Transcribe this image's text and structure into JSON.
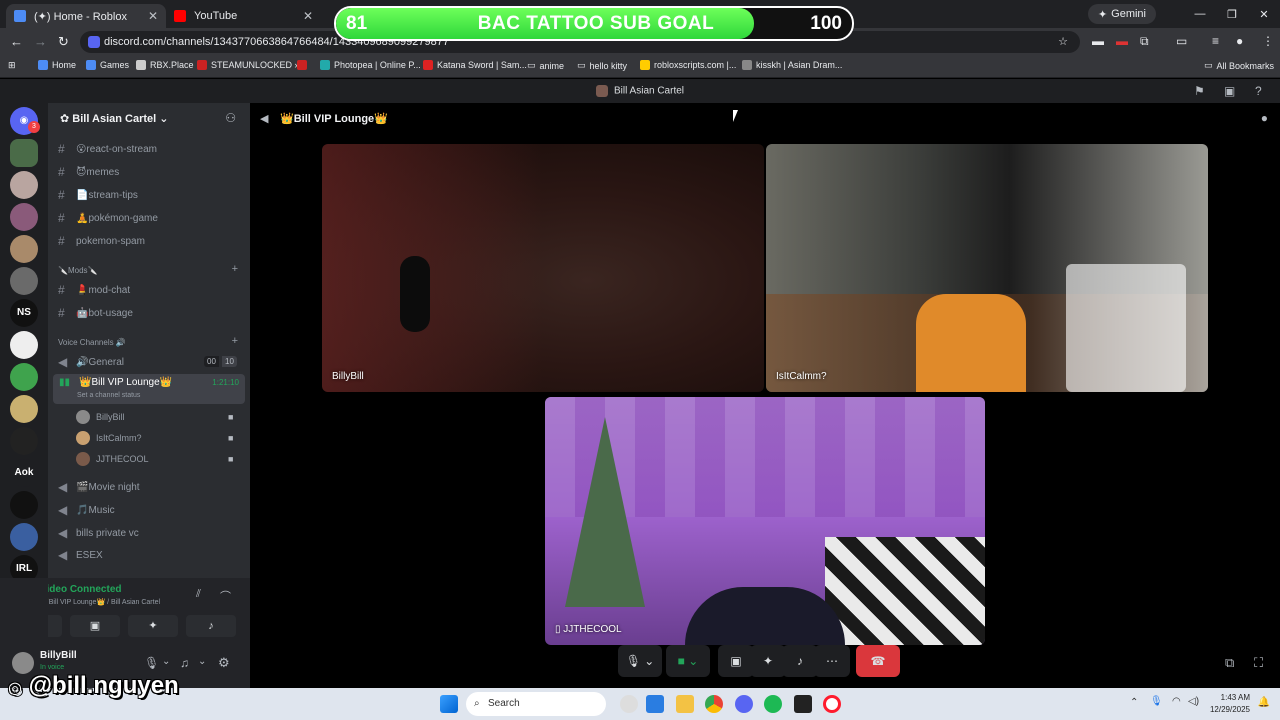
{
  "browser": {
    "tabs": [
      {
        "title": "(✦) Home - Roblox",
        "color": "#4d8cf5"
      },
      {
        "title": "YouTube",
        "color": "#ff0000"
      }
    ],
    "gemini_label": "Gemini",
    "url": "discord.com/channels/1343770663864766484/1433409689099279877",
    "bookmarks": [
      "Home",
      "Games",
      "RBX.Place",
      "STEAMUNLOCKED »...",
      "Photopea | Online P...",
      "Katana Sword | Sam...",
      "anime",
      "hello kitty",
      "robloxscripts.com |...",
      "kisskh | Asian Dram..."
    ],
    "all_bookmarks": "All Bookmarks"
  },
  "overlay": {
    "current": "81",
    "goal": "100",
    "title": "BAC TATTOO SUB GOAL",
    "progress": 0.81,
    "watermark": "@bill.nguyen"
  },
  "discord": {
    "server_header": "Bill Asian Cartel",
    "server_name": "Bill Asian Cartel",
    "guild_labels": [
      "NS",
      "Aok",
      "IRL"
    ],
    "mention_badge": "3",
    "channels": [
      {
        "name": "😮react-on-stream",
        "type": "text"
      },
      {
        "name": "😈memes",
        "type": "text"
      },
      {
        "name": "📄stream-tips",
        "type": "text"
      },
      {
        "name": "🧘pokémon-game",
        "type": "text"
      },
      {
        "name": "pokemon-spam",
        "type": "text"
      }
    ],
    "mods_category": "🔪Mods🔪",
    "mod_channels": [
      "💄mod-chat",
      "🤖bot-usage"
    ],
    "voice_category": "Voice Channels 🔊",
    "general": {
      "name": "🔊General",
      "count_a": "00",
      "count_b": "10"
    },
    "active_vc": {
      "name": "👑Bill VIP Lounge👑",
      "timer": "1:21:10",
      "status": "Set a channel status"
    },
    "members": [
      "BillyBill",
      "IsItCalmm?",
      "JJTHECOOL"
    ],
    "other_vcs": [
      "🎬Movie night",
      "🎵Music",
      "bills private vc",
      "ESEX"
    ],
    "voice_panel": {
      "status": "Video Connected",
      "location": "👑Bill VIP Lounge👑 / Bill Asian Cartel"
    },
    "user": {
      "name": "BillyBill",
      "status": "In voice"
    },
    "stage_title": "👑Bill VIP Lounge👑",
    "tiles": [
      {
        "name": "BillyBill"
      },
      {
        "name": "IsItCalmm?"
      },
      {
        "name": "JJTHECOOL"
      }
    ]
  },
  "taskbar": {
    "search": "Search",
    "time": "1:43 AM",
    "date": "12/29/2025"
  }
}
